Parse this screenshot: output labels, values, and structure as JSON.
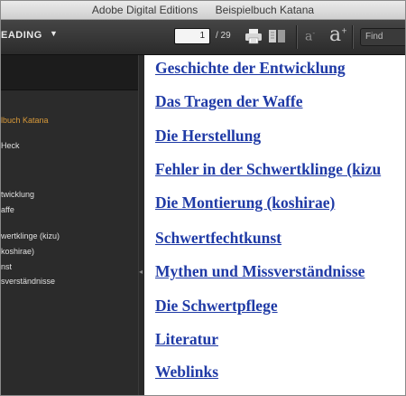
{
  "window": {
    "app_title": "Adobe Digital Editions",
    "doc_title": "Beispielbuch Katana"
  },
  "toolbar": {
    "library_label": "EADING",
    "library_caret": "▼",
    "page_current": "1",
    "page_total": "/ 29",
    "font_small_label": "a",
    "font_small_sup": "-",
    "font_big_label": "a",
    "font_big_sup": "+",
    "find_placeholder": "Find"
  },
  "sidebar": {
    "items": [
      {
        "label": "lbuch Katana",
        "active": true
      },
      {
        "label": "Heck",
        "active": false
      },
      {
        "label": "twicklung",
        "active": false
      },
      {
        "label": "affe",
        "active": false
      },
      {
        "label": "wertklinge (kizu)",
        "active": false
      },
      {
        "label": "koshirae)",
        "active": false
      },
      {
        "label": "nst",
        "active": false
      },
      {
        "label": "sverständnisse",
        "active": false
      }
    ]
  },
  "content": {
    "chapters": [
      "Geschichte der Entwicklung",
      "Das Tragen der Waffe",
      "Die Herstellung",
      "Fehler in der Schwertklinge (kizu",
      "Die Montierung (koshirae)",
      "Schwertfechtkunst",
      "Mythen und Missverständnisse",
      "Die Schwertpflege",
      "Literatur",
      "Weblinks"
    ]
  }
}
